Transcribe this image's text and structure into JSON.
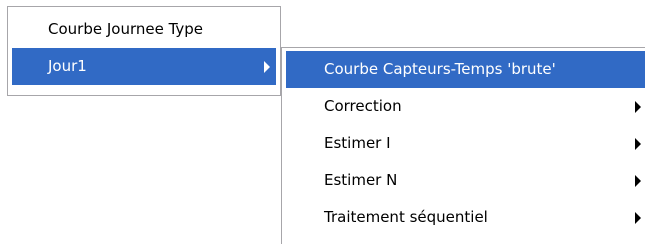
{
  "main_menu": {
    "items": [
      {
        "label": "Courbe Journee Type",
        "has_submenu": false,
        "highlighted": false
      },
      {
        "label": "Jour1",
        "has_submenu": true,
        "highlighted": true,
        "arrow_icon": "submenu-arrow-icon"
      }
    ]
  },
  "sub_menu": {
    "items": [
      {
        "label": "Courbe Capteurs-Temps 'brute'",
        "has_submenu": false,
        "highlighted": true
      },
      {
        "label": "Correction",
        "has_submenu": true,
        "highlighted": false,
        "arrow_icon": "submenu-arrow-icon"
      },
      {
        "label": "Estimer I",
        "has_submenu": true,
        "highlighted": false,
        "arrow_icon": "submenu-arrow-icon"
      },
      {
        "label": "Estimer N",
        "has_submenu": true,
        "highlighted": false,
        "arrow_icon": "submenu-arrow-icon"
      },
      {
        "label": "Traitement séquentiel",
        "has_submenu": true,
        "highlighted": false,
        "arrow_icon": "submenu-arrow-icon"
      }
    ]
  },
  "colors": {
    "highlight_background": "#316ac5",
    "highlight_text": "#ffffff",
    "menu_border": "#a7a6aa",
    "menu_background": "#ffffff"
  }
}
